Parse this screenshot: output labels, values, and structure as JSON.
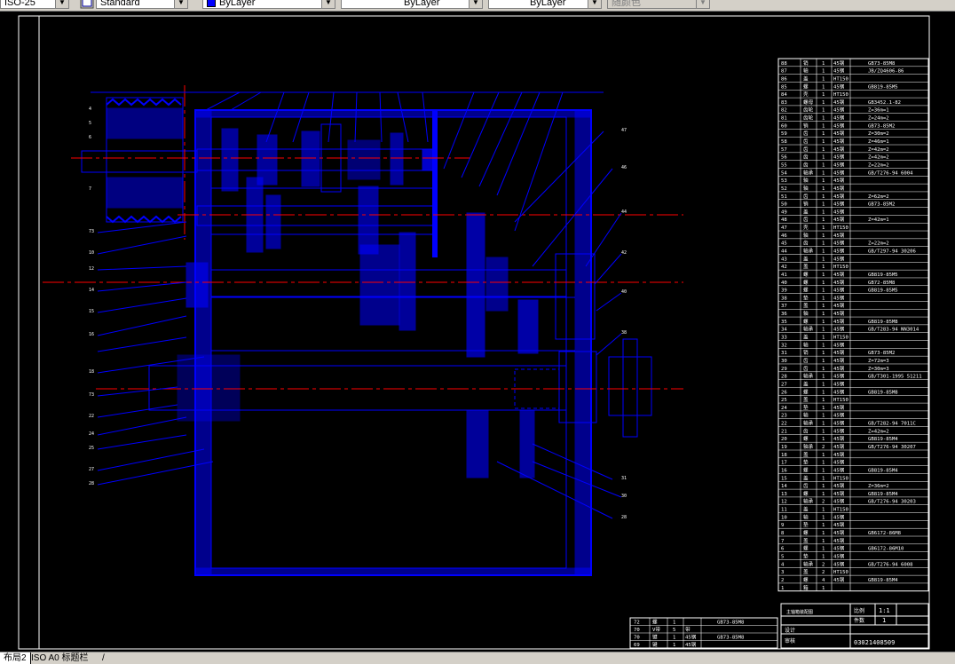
{
  "toolbar": {
    "dim_style_value": "ISO-25",
    "text_style_value": "Standard",
    "layer_value": "ByLayer",
    "linetype_value": "ByLayer",
    "lineweight_value": "ByLayer",
    "plotstyle_value": "随颜色"
  },
  "colors": {
    "background": "#000000",
    "frame": "#ffffff",
    "geometry": "#0000ff",
    "centerline": "#ff0000",
    "leader": "#0000ff",
    "text": "#ffffff"
  },
  "tabs": [
    {
      "label": "布局2",
      "active": true
    },
    {
      "label": "ISO A0 标题栏",
      "active": false
    },
    {
      "label": "/",
      "active": false
    }
  ],
  "parts_list": [
    {
      "no": "88",
      "name": "销",
      "qty": "1",
      "mat": "45钢",
      "std": "GB73-85M8"
    },
    {
      "no": "87",
      "name": "轴",
      "qty": "1",
      "mat": "45钢",
      "std": "JB/ZQ4606-86"
    },
    {
      "no": "86",
      "name": "盖",
      "qty": "1",
      "mat": "HT150",
      "std": ""
    },
    {
      "no": "85",
      "name": "螺",
      "qty": "1",
      "mat": "45钢",
      "std": "GB819-85M5"
    },
    {
      "no": "84",
      "name": "壳",
      "qty": "1",
      "mat": "HT150",
      "std": ""
    },
    {
      "no": "83",
      "name": "螺母",
      "qty": "1",
      "mat": "45钢",
      "std": "GB3452.1-82"
    },
    {
      "no": "82",
      "name": "齿轮",
      "qty": "1",
      "mat": "45钢",
      "std": "Z=36m=1"
    },
    {
      "no": "81",
      "name": "齿轮",
      "qty": "1",
      "mat": "45钢",
      "std": "Z=24m=2"
    },
    {
      "no": "60",
      "name": "销",
      "qty": "1",
      "mat": "45钢",
      "std": "GB73-85M2"
    },
    {
      "no": "59",
      "name": "齿",
      "qty": "1",
      "mat": "45钢",
      "std": "Z=30m=2"
    },
    {
      "no": "58",
      "name": "齿",
      "qty": "1",
      "mat": "45钢",
      "std": "Z=46m=1"
    },
    {
      "no": "57",
      "name": "齿",
      "qty": "1",
      "mat": "45钢",
      "std": "Z=42m=2"
    },
    {
      "no": "56",
      "name": "齿",
      "qty": "1",
      "mat": "45钢",
      "std": "Z=42m=2"
    },
    {
      "no": "55",
      "name": "齿",
      "qty": "1",
      "mat": "45钢",
      "std": "Z=22m=2"
    },
    {
      "no": "54",
      "name": "轴承",
      "qty": "1",
      "mat": "45钢",
      "std": "GB/T276-94 6004"
    },
    {
      "no": "53",
      "name": "轴",
      "qty": "1",
      "mat": "45钢",
      "std": ""
    },
    {
      "no": "52",
      "name": "轴",
      "qty": "1",
      "mat": "45钢",
      "std": ""
    },
    {
      "no": "51",
      "name": "齿",
      "qty": "1",
      "mat": "45钢",
      "std": "Z=62m=2"
    },
    {
      "no": "50",
      "name": "销",
      "qty": "1",
      "mat": "45钢",
      "std": "GB73-85M2"
    },
    {
      "no": "49",
      "name": "盖",
      "qty": "1",
      "mat": "45钢",
      "std": ""
    },
    {
      "no": "48",
      "name": "齿",
      "qty": "1",
      "mat": "45钢",
      "std": "Z=42m=1"
    },
    {
      "no": "47",
      "name": "壳",
      "qty": "1",
      "mat": "HT150",
      "std": ""
    },
    {
      "no": "46",
      "name": "轴",
      "qty": "1",
      "mat": "45钢",
      "std": ""
    },
    {
      "no": "45",
      "name": "齿",
      "qty": "1",
      "mat": "45钢",
      "std": "Z=22m=2"
    },
    {
      "no": "44",
      "name": "轴承",
      "qty": "1",
      "mat": "45钢",
      "std": "GB/T297-94 30206"
    },
    {
      "no": "43",
      "name": "盖",
      "qty": "1",
      "mat": "45钢",
      "std": ""
    },
    {
      "no": "42",
      "name": "盖",
      "qty": "1",
      "mat": "HT150",
      "std": ""
    },
    {
      "no": "41",
      "name": "螺",
      "qty": "1",
      "mat": "45钢",
      "std": "GB819-85M5"
    },
    {
      "no": "40",
      "name": "螺",
      "qty": "1",
      "mat": "45钢",
      "std": "GB72-85M8"
    },
    {
      "no": "39",
      "name": "螺",
      "qty": "1",
      "mat": "45钢",
      "std": "GB819-85M5"
    },
    {
      "no": "38",
      "name": "垫",
      "qty": "1",
      "mat": "45钢",
      "std": ""
    },
    {
      "no": "37",
      "name": "盖",
      "qty": "1",
      "mat": "45钢",
      "std": ""
    },
    {
      "no": "36",
      "name": "轴",
      "qty": "1",
      "mat": "45钢",
      "std": ""
    },
    {
      "no": "35",
      "name": "螺",
      "qty": "1",
      "mat": "45钢",
      "std": "GB819-85M8"
    },
    {
      "no": "34",
      "name": "轴承",
      "qty": "1",
      "mat": "45钢",
      "std": "GB/T283-94 NN3014"
    },
    {
      "no": "33",
      "name": "盖",
      "qty": "1",
      "mat": "HT150",
      "std": ""
    },
    {
      "no": "32",
      "name": "轴",
      "qty": "1",
      "mat": "45钢",
      "std": ""
    },
    {
      "no": "31",
      "name": "销",
      "qty": "1",
      "mat": "45钢",
      "std": "GB73-85M2"
    },
    {
      "no": "30",
      "name": "齿",
      "qty": "1",
      "mat": "45钢",
      "std": "Z=72m=3"
    },
    {
      "no": "29",
      "name": "齿",
      "qty": "1",
      "mat": "45钢",
      "std": "Z=30m=3"
    },
    {
      "no": "28",
      "name": "轴承",
      "qty": "1",
      "mat": "45钢",
      "std": "GB/T301-1995 51211"
    },
    {
      "no": "27",
      "name": "盖",
      "qty": "1",
      "mat": "45钢",
      "std": ""
    },
    {
      "no": "26",
      "name": "螺",
      "qty": "1",
      "mat": "45钢",
      "std": "GB819-85M8"
    },
    {
      "no": "25",
      "name": "盖",
      "qty": "1",
      "mat": "HT150",
      "std": ""
    },
    {
      "no": "24",
      "name": "垫",
      "qty": "1",
      "mat": "45钢",
      "std": ""
    },
    {
      "no": "23",
      "name": "轴",
      "qty": "1",
      "mat": "45钢",
      "std": ""
    },
    {
      "no": "22",
      "name": "轴承",
      "qty": "1",
      "mat": "45钢",
      "std": "GB/T282-94 7011C"
    },
    {
      "no": "21",
      "name": "齿",
      "qty": "1",
      "mat": "45钢",
      "std": "Z=42m=2"
    },
    {
      "no": "20",
      "name": "螺",
      "qty": "1",
      "mat": "45钢",
      "std": "GB819-85M4"
    },
    {
      "no": "19",
      "name": "轴承",
      "qty": "2",
      "mat": "45钢",
      "std": "GB/T276-94 30207"
    },
    {
      "no": "18",
      "name": "盖",
      "qty": "1",
      "mat": "45钢",
      "std": ""
    },
    {
      "no": "17",
      "name": "垫",
      "qty": "1",
      "mat": "45钢",
      "std": ""
    },
    {
      "no": "16",
      "name": "螺",
      "qty": "1",
      "mat": "45钢",
      "std": "GB819-85M4"
    },
    {
      "no": "15",
      "name": "盖",
      "qty": "1",
      "mat": "HT150",
      "std": ""
    },
    {
      "no": "14",
      "name": "齿",
      "qty": "1",
      "mat": "45钢",
      "std": "Z=36m=2"
    },
    {
      "no": "13",
      "name": "螺",
      "qty": "1",
      "mat": "45钢",
      "std": "GB819-85M4"
    },
    {
      "no": "12",
      "name": "轴承",
      "qty": "2",
      "mat": "45钢",
      "std": "GB/T276-94 30203"
    },
    {
      "no": "11",
      "name": "盖",
      "qty": "1",
      "mat": "HT150",
      "std": ""
    },
    {
      "no": "10",
      "name": "轴",
      "qty": "1",
      "mat": "45钢",
      "std": ""
    },
    {
      "no": "9",
      "name": "垫",
      "qty": "1",
      "mat": "45钢",
      "std": ""
    },
    {
      "no": "8",
      "name": "螺",
      "qty": "1",
      "mat": "45钢",
      "std": "GB6172-86M8"
    },
    {
      "no": "7",
      "name": "盖",
      "qty": "1",
      "mat": "45钢",
      "std": ""
    },
    {
      "no": "6",
      "name": "螺",
      "qty": "1",
      "mat": "45钢",
      "std": "GB6172-86M10"
    },
    {
      "no": "5",
      "name": "垫",
      "qty": "1",
      "mat": "45钢",
      "std": ""
    },
    {
      "no": "4",
      "name": "轴承",
      "qty": "2",
      "mat": "45钢",
      "std": "GB/T276-94 6008"
    },
    {
      "no": "3",
      "name": "盖",
      "qty": "2",
      "mat": "HT150",
      "std": ""
    },
    {
      "no": "2",
      "name": "螺",
      "qty": "4",
      "mat": "45钢",
      "std": "GB819-85M4"
    },
    {
      "no": "1",
      "name": "箱",
      "qty": "1",
      "mat": "",
      "std": ""
    }
  ],
  "title_block": {
    "scale_label": "比例",
    "scale_value": "1:1",
    "qty_label": "件数",
    "qty_value": "1",
    "school_text": "03021408509",
    "drawing_name": "主轴箱装配图",
    "designer_label": "设计",
    "checker_label": "审核"
  },
  "left_rows": [
    {
      "no": "72",
      "name": "螺",
      "qty": "1",
      "mat": "",
      "std": "GB73-85M8"
    },
    {
      "no": "70",
      "name": "V带",
      "qty": "5",
      "mat": "带",
      "std": ""
    },
    {
      "no": "70",
      "name": "键",
      "qty": "1",
      "mat": "45钢",
      "std": "GB73-85M8"
    },
    {
      "no": "69",
      "name": "键",
      "qty": "1",
      "mat": "45钢",
      "std": ""
    }
  ]
}
